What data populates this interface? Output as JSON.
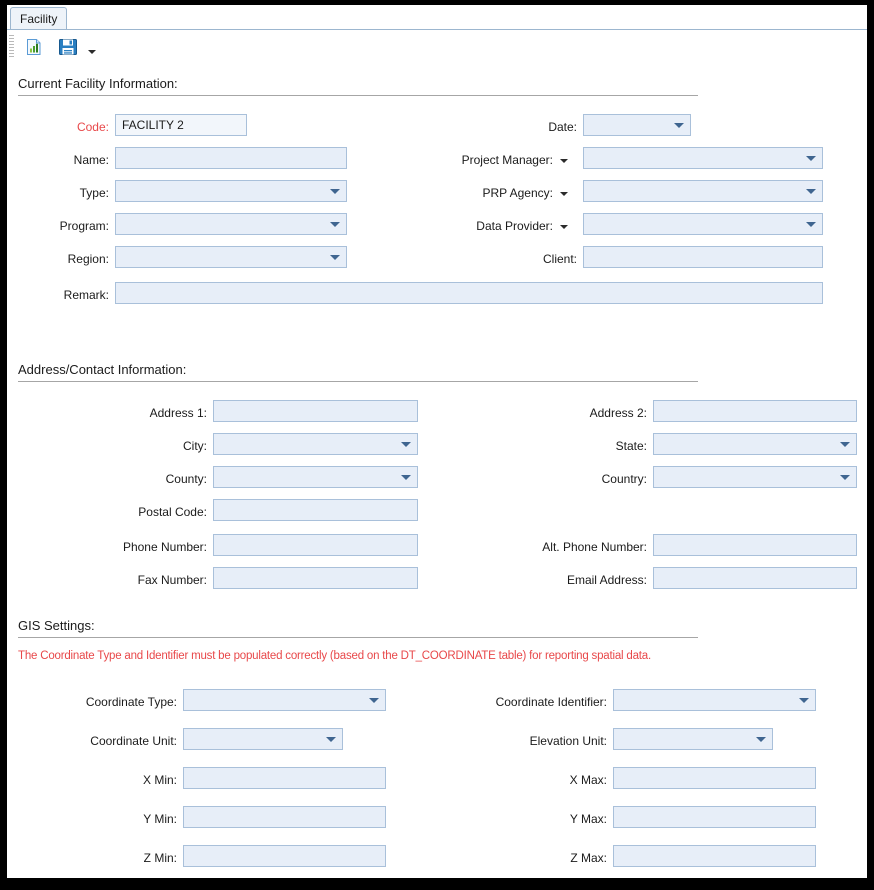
{
  "window": {
    "tab_label": "Facility"
  },
  "toolbar": {
    "report_icon": "report-chart-icon",
    "save_icon": "save-floppy-icon",
    "save_dropdown_icon": "chevron-down-icon"
  },
  "sections": {
    "current_facility": {
      "title": "Current Facility Information:",
      "fields": {
        "code": {
          "label": "Code:",
          "value": "FACILITY 2"
        },
        "name": {
          "label": "Name:",
          "value": ""
        },
        "type": {
          "label": "Type:",
          "value": ""
        },
        "program": {
          "label": "Program:",
          "value": ""
        },
        "region": {
          "label": "Region:",
          "value": ""
        },
        "remark": {
          "label": "Remark:",
          "value": ""
        },
        "date": {
          "label": "Date:",
          "value": ""
        },
        "project_manager": {
          "label": "Project Manager:",
          "value": ""
        },
        "prp_agency": {
          "label": "PRP Agency:",
          "value": ""
        },
        "data_provider": {
          "label": "Data Provider:",
          "value": ""
        },
        "client": {
          "label": "Client:",
          "value": ""
        }
      }
    },
    "address_contact": {
      "title": "Address/Contact Information:",
      "fields": {
        "address1": {
          "label": "Address 1:",
          "value": ""
        },
        "city": {
          "label": "City:",
          "value": ""
        },
        "county": {
          "label": "County:",
          "value": ""
        },
        "postal_code": {
          "label": "Postal Code:",
          "value": ""
        },
        "phone_number": {
          "label": "Phone Number:",
          "value": ""
        },
        "fax_number": {
          "label": "Fax Number:",
          "value": ""
        },
        "address2": {
          "label": "Address 2:",
          "value": ""
        },
        "state": {
          "label": "State:",
          "value": ""
        },
        "country": {
          "label": "Country:",
          "value": ""
        },
        "alt_phone_number": {
          "label": "Alt. Phone Number:",
          "value": ""
        },
        "email_address": {
          "label": "Email Address:",
          "value": ""
        }
      }
    },
    "gis_settings": {
      "title": "GIS Settings:",
      "warning": "The Coordinate Type and Identifier must be populated correctly (based on the DT_COORDINATE table) for reporting spatial data.",
      "fields": {
        "coordinate_type": {
          "label": "Coordinate Type:",
          "value": ""
        },
        "coordinate_unit": {
          "label": "Coordinate Unit:",
          "value": ""
        },
        "x_min": {
          "label": "X Min:",
          "value": ""
        },
        "y_min": {
          "label": "Y Min:",
          "value": ""
        },
        "z_min": {
          "label": "Z Min:",
          "value": ""
        },
        "coordinate_identifier": {
          "label": "Coordinate Identifier:",
          "value": ""
        },
        "elevation_unit": {
          "label": "Elevation Unit:",
          "value": ""
        },
        "x_max": {
          "label": "X Max:",
          "value": ""
        },
        "y_max": {
          "label": "Y Max:",
          "value": ""
        },
        "z_max": {
          "label": "Z Max:",
          "value": ""
        }
      }
    }
  },
  "colors": {
    "field_background": "#e7eef8",
    "field_border": "#a9c0da",
    "required_label": "#e8484a",
    "warning_text": "#e8484a",
    "dropdown_arrow": "#3f6590",
    "tab_border": "#9cb6cf"
  }
}
